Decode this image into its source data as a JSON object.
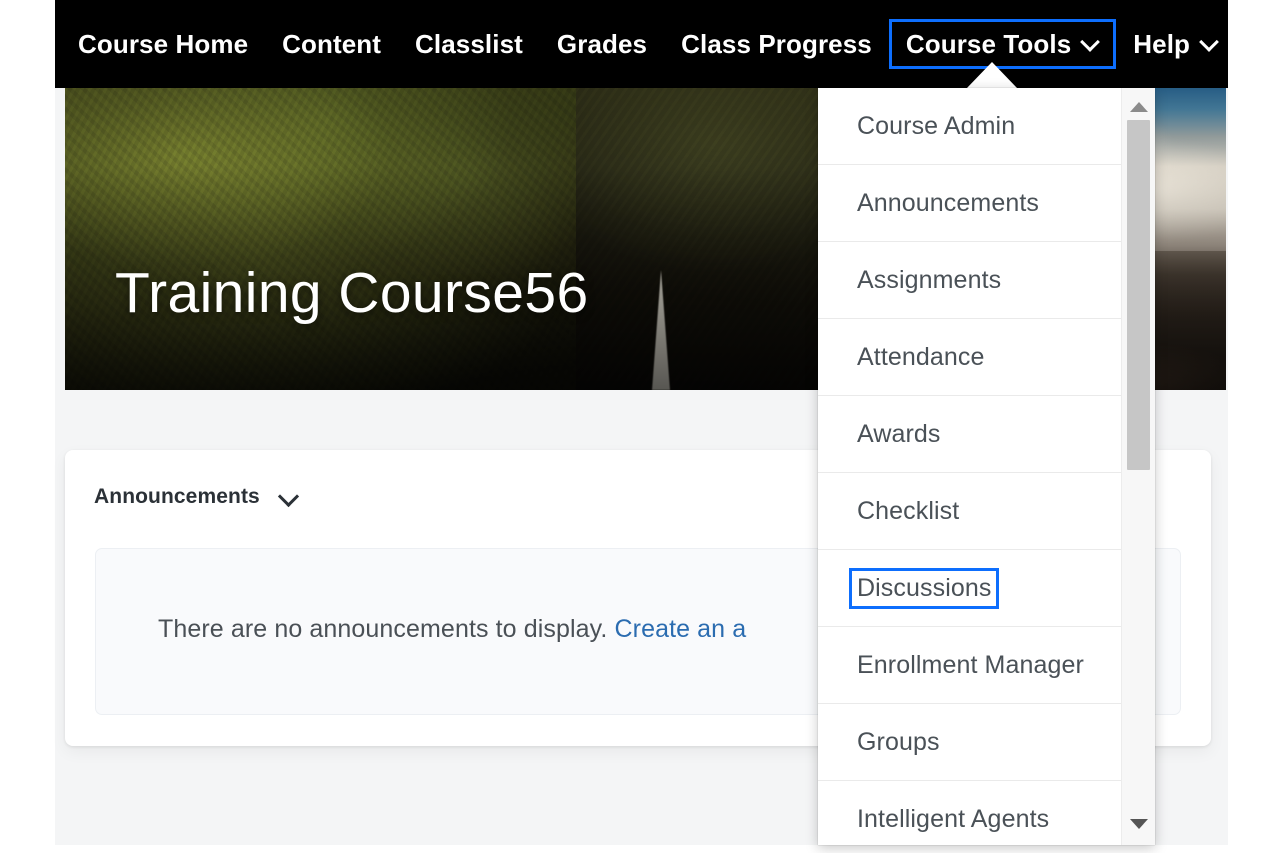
{
  "navbar": {
    "items": [
      {
        "label": "Course Home",
        "has_caret": false,
        "focused": false
      },
      {
        "label": "Content",
        "has_caret": false,
        "focused": false
      },
      {
        "label": "Classlist",
        "has_caret": false,
        "focused": false
      },
      {
        "label": "Grades",
        "has_caret": false,
        "focused": false
      },
      {
        "label": "Class Progress",
        "has_caret": false,
        "focused": false
      },
      {
        "label": "Course Tools",
        "has_caret": true,
        "focused": true
      },
      {
        "label": "Help",
        "has_caret": true,
        "focused": false
      }
    ],
    "background_color": "#000000",
    "focus_ring_color": "#0d6efd"
  },
  "hero": {
    "course_title": "Training Course56"
  },
  "announcements_card": {
    "title": "Announcements",
    "collapse_icon": "chevron-down-icon",
    "empty_message_prefix": "There are no announcements to display. ",
    "empty_message_link": "Create an a",
    "link_color": "#2b6cb0"
  },
  "course_tools_menu": {
    "focused_item": "Discussions",
    "items": [
      {
        "label": "Course Admin",
        "focused": false
      },
      {
        "label": "Announcements",
        "focused": false
      },
      {
        "label": "Assignments",
        "focused": false
      },
      {
        "label": "Attendance",
        "focused": false
      },
      {
        "label": "Awards",
        "focused": false
      },
      {
        "label": "Checklist",
        "focused": false
      },
      {
        "label": "Discussions",
        "focused": true
      },
      {
        "label": "Enrollment Manager",
        "focused": false
      },
      {
        "label": "Groups",
        "focused": false
      },
      {
        "label": "Intelligent Agents",
        "focused": false
      }
    ],
    "scrollbar": {
      "up_arrow_icon": "triangle-up-icon",
      "down_arrow_icon": "triangle-down-icon"
    }
  }
}
